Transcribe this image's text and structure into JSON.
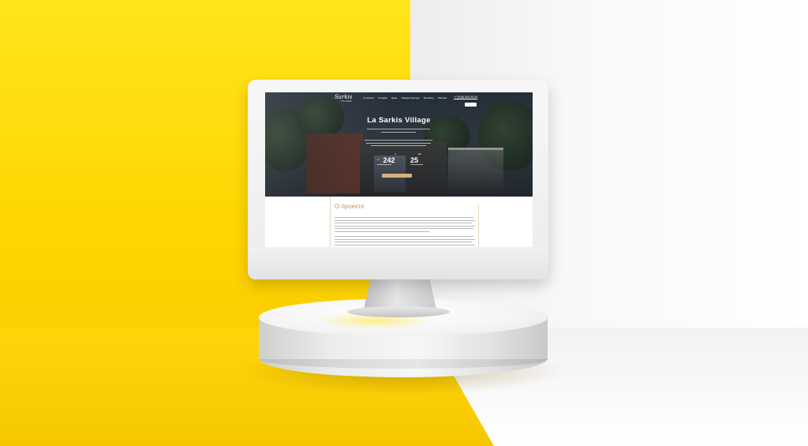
{
  "site": {
    "logo_script": "Sarkis",
    "logo_sub": "VILLAGE",
    "nav": {
      "links": [
        "О проекте",
        "Котеджи",
        "Цены",
        "Инфраструктура",
        "Контакты",
        "Ипотека"
      ],
      "phone": "+7 (918) 000-00-00"
    },
    "hero": {
      "title": "La Sarkis Village",
      "stats": [
        {
          "prefix": "от",
          "value": "242",
          "unit": "с"
        },
        {
          "value": "25",
          "unit": "км"
        }
      ]
    },
    "about": {
      "title": "О проекте"
    }
  },
  "colors": {
    "background_left": "#ffd400",
    "background_right": "#f4f4f4",
    "accent": "#c29a62",
    "hero_dark": "#2f3a44"
  },
  "icons": {
    "logo": "sarkis-village-logo-icon"
  }
}
